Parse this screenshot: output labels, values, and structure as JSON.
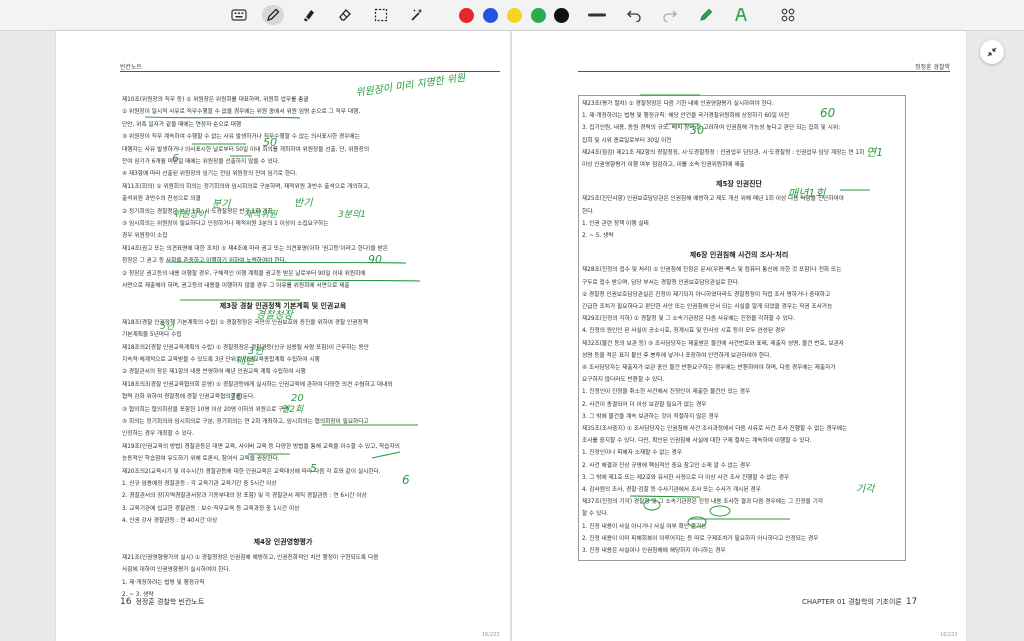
{
  "toolbar": {
    "colors": [
      "#e5262a",
      "#2356e0",
      "#f5d423",
      "#2aab4f",
      "#111111"
    ]
  },
  "left_page": {
    "header": "빈칸노트",
    "lines": [
      "제10조(위원장의 직무 등) ① 위원장은 위원회를 대표하며, 위원회 업무를 총괄",
      "② 위원장이 일시적 사유로 직무수행할 수 없을 경우에는 위원 중에서 위원 임명 순으로 그 직무 대행,",
      "단만, 위촉 일자가 같을 때에는 연장자 순으로 대행",
      "③ 위원장이 직무 계속하여 수행할 수 없는 사유 발생하거나 직무수행할 수 없는 의사표시한 경우에는",
      "대행자는 사유 발생하거나 의사표시한 날로부터 50일 이내 회의를 개최하여 위원장을 선출. 단, 위원장의",
      "잔여 임기가 6개월 미만일 때에는 위원장을 선출하지 않을 수 있다.",
      "④ 제3항에 따라 선출된 위원장의 임기는 전임 위원장의 잔여 임기로 한다.",
      "제11조(회의) ① 위원회의 회의는 정기회의와 임시회의로 구분하며, 재적위원 과반수 출석으로 개의하고,",
      "출석위원 과반수의 찬성으로 의결",
      "② 정기회의는 경찰청은 분기 1회, 시·도경찰청은 반기 1회 개최",
      "③ 임시회의는 위원장이 필요하다고 인정하거나 재적위원 3분의 1 이상이 소집요구하는",
      "경우 위원장이 소집",
      "제14조(권고 또는 의견표명에 대한 조치) ① 제4조에 따라 권고 또는 의견표명(이하 '권고등'이라고 한다)을 받은",
      "청장은 그 권고 등 사항을 존중하고 이행하기 위하여 노력하여야 한다.",
      "② 청장은 권고등의 내용 이행할 경우, 구체적인 이행 계획을 권고등 받은 날로부터 90일 이내 위원회에",
      "서면으로 제출해야 하며, 권고등의 내용을 이행하지 않을 경우 그 이유를 위원회에 서면으로 제출",
      "제3장 경찰 인권정책 기본계획 및 인권교육",
      "제18조(경찰 인권정책 기본계획의 수립) ① 경찰청장은 국민의 인권보호와 증진을 위하여 경찰 인권정책",
      "기본계획을 5년마다 수립",
      "제18조의2(경찰 인권교육계획의 수립) ① 경찰청장은 경찰관등(신규 임용될 사람 포함)이 근무하는 동안",
      "지속적·체계적으로 교육받을 수 있도록 3년 단위로 인권교육종합계획 수립하여 시행",
      "② 경찰관서의 장은 제1항의 내용 반영하여 매년 인권교육 계획 수립하여 시행",
      "제18조의3(경찰 인권교육협의회 운영) ① 경찰관등에게 실시하는 인권교육에 관하여 다양한 의견 수렴하고 대내외",
      "협력 강화 위하여 경찰청에 경찰 인권교육협의회를 둔다.",
      "③ 협의회는 협의회장을 포함한 10명 이상 20명 이하의 위원으로 구성",
      "⑤ 회의는 정기회의와 임시회의로 구분, 정기회의는 연 2회 개최하고, 임시회의는 협의회장이 필요하다고",
      "인정하는 경우 개최할 수 있다.",
      "제19조(인권교육의 방법) 경찰관등은 대면 교육, 사이버 교육 등 다양한 방법을 통해 교육을 이수할 수 있고, 학습자의",
      "능동적인 학습참여 유도하기 위해 토론식, 참여식 교육을 권장한다.",
      "제20조의2(교육시기 및 이수시간) 경찰관등에 대한 인권교육은 교육대상에 따라 다음 각 호와 같이 실시한다.",
      "1. 신규 임용예정 경찰관등 : 각 교육기관 교육기간 중 5시간 이상",
      "2. 경찰관서의 장(지역경찰관서장과 기동부대의 장 포함) 및 각 경찰관서 재직 경찰관등 : 연 6시간 이상",
      "3. 교육기관에 입교한 경찰관등 : 보수·직무교육 등 교육과정 중 1시간 이상",
      "4. 인권 강사 경찰관등 : 연 40시간 이상",
      "제4장 인권영향평가",
      "제21조(인권영향평가의 실시) ① 경찰청장은 인권침해 예방하고, 인권친화적인 치안 행정이 구현되도록 다음",
      "사항에 대하여 인권영향평가 실시하여야 한다.",
      "1. 제·개정하려는 법령 및 행정규칙",
      "2. ~ 3. 생략"
    ],
    "footer_num": "16",
    "footer_text": "정정훈 경찰학 빈칸노트",
    "page_counter": "16/223"
  },
  "right_page": {
    "header": "정정훈 경찰학",
    "lines": [
      "제23조(평가 절차) ① 경찰청장은 다음 기한 내에 인권영향평가 실시하여야 한다.",
      "1. 제·개정하려는 법령 및 행정규칙: 해당 안건을 국가경찰위원회에 상정하기 60일 이전",
      "3. 집기인원, 내용, 동원 경력의 규모, 배치 장비 등 고려하여 인권침해 가능성 높다고 판단 되는 집회 및 시위:",
      "집회 및 시위 종료일로부터 30일 이전",
      "제24조(점검) 제21조 제2항의 경찰청장, 시·도경찰청장 : 인권업무 담당관, 시·도경찰청 : 인권업무 담당 계장는 연 1회",
      "이상 인권영향평가 이행 여부 점검하고, 이를 소속 인권위원회에 제출",
      "제5장 인권진단",
      "제25조(진단사항) 인권보호담당관은 인권침해 예방하고 제도 개선 위해 매년 1회 이상 다음 사항을 진단하여야",
      "한다.",
      "1. 인권 관련 정책 이행 실태",
      "2. ~ 5. 생략",
      "제6장 인권침해 사건의 조사·처리",
      "제28조(진정의 접수 및 처리) ① 인권침해 진정은 문서(우편·팩스 및 컴퓨터 통신에 의한 것 포함)나 전화 또는",
      "구두로 접수 받으며, 담당 부서는 경찰청 인권보호담당관실로 한다.",
      "② 경찰청 인권보호담당관실은 진정이 제기되지 아니하였더라도 경찰청장이 직접 조사 명하거나 중대하고",
      "긴급한 조치가 필요하다고 판단한 사안 또는 인권침해 단서 되는 사실을 알게 되었을 경우는 직권 조사가능",
      "제29조(진정의 각하) ① 경찰청 및 그 소속기관장은 다음 사유에는 진정을 각하할 수 있다.",
      "4. 진정의 원인인 된 사실이 공소시효, 징계시효 및 민사상 시효 등이 모두 완성된 경우",
      "제32조(물건 등의 보관 등) ③ 조사담당자는 제출받은 물건에 사건번호와 표제, 제출자 성명, 물건 번호, 보관자",
      "성명 등을 적은 표지 붙인 후 봉투에 넣거나 포장하여 안전하게 보관하여야 한다.",
      "⑥ 조사담당자는 제출자가 보관 중인 물건 반환요구하는 경우에는 반환하여야 하며, 다음 경우에는 제출자가",
      "요구하지 않더라도 반환할 수 있다.",
      "1. 진정인이 진정을 취소한 사건에서 진정인이 제출한 물건인 있는 경우",
      "2. 사건이 종결되어 더 이상 보관할 필요가 없는 경우",
      "3. 그 밖에 물건을 계속 보관하는 것이 적절하지 않은 경우",
      "제35조(조사중지) ① 조사담당자는 인권침해 사건 조사과정에서 다음 사유로 사건 조사 진행할 수 없는 경우에는",
      "조사를 중지할 수 있다. 다만, 확인된 인권침해 사실에 대한 구제 절차는 계속하여 이행할 수 있다.",
      "1. 진정인이나 피해자 소재할 수 없는 경우",
      "2. 사건 해결과 진상 규명에 핵심적인 중요 참고인 소재 알 수 없는 경우",
      "3. 그 밖에 제1호 또는 제2호와 유사한 사정으로 더 이상 사건 조사 진행할 수 없는 경우",
      "4. 감사원의 조사, 경찰·검찰 등 수사기관에서 조사 또는 수사가 개시된 경우",
      "제37조(진정의 기각) 경찰청 및 그 소속기관장은 진정 내용 조사한 결과 다음 경우에는 그 진정을 기각",
      "할 수 있다.",
      "1. 진정 내용이 사실 아니거나 사실 여부 확인 불가능",
      "2. 진정 내용이 이미 피해회복이 이루어지는 등 따로 구제조치가 필요하지 아니하다고 인정되는 경우",
      "3. 진정 내용은 사실이나 인권침해에 해당하지 아니하는 경우"
    ],
    "footer_text": "CHAPTER 01 경찰학의 기초이론",
    "footer_num": "17",
    "page_counter": "16/223"
  },
  "handwriting": {
    "left": [
      "위원장이 미리 지명한 위원",
      "50",
      "6",
      "분기",
      "반기",
      "위원장이",
      "재적위원",
      "3분의1",
      "90",
      "경찰청장",
      "5년",
      "3년",
      "매년",
      "10",
      "20",
      "연2회",
      "5",
      "6"
    ],
    "right": [
      "60",
      "30",
      "연1",
      "매년1회",
      "기각"
    ]
  }
}
